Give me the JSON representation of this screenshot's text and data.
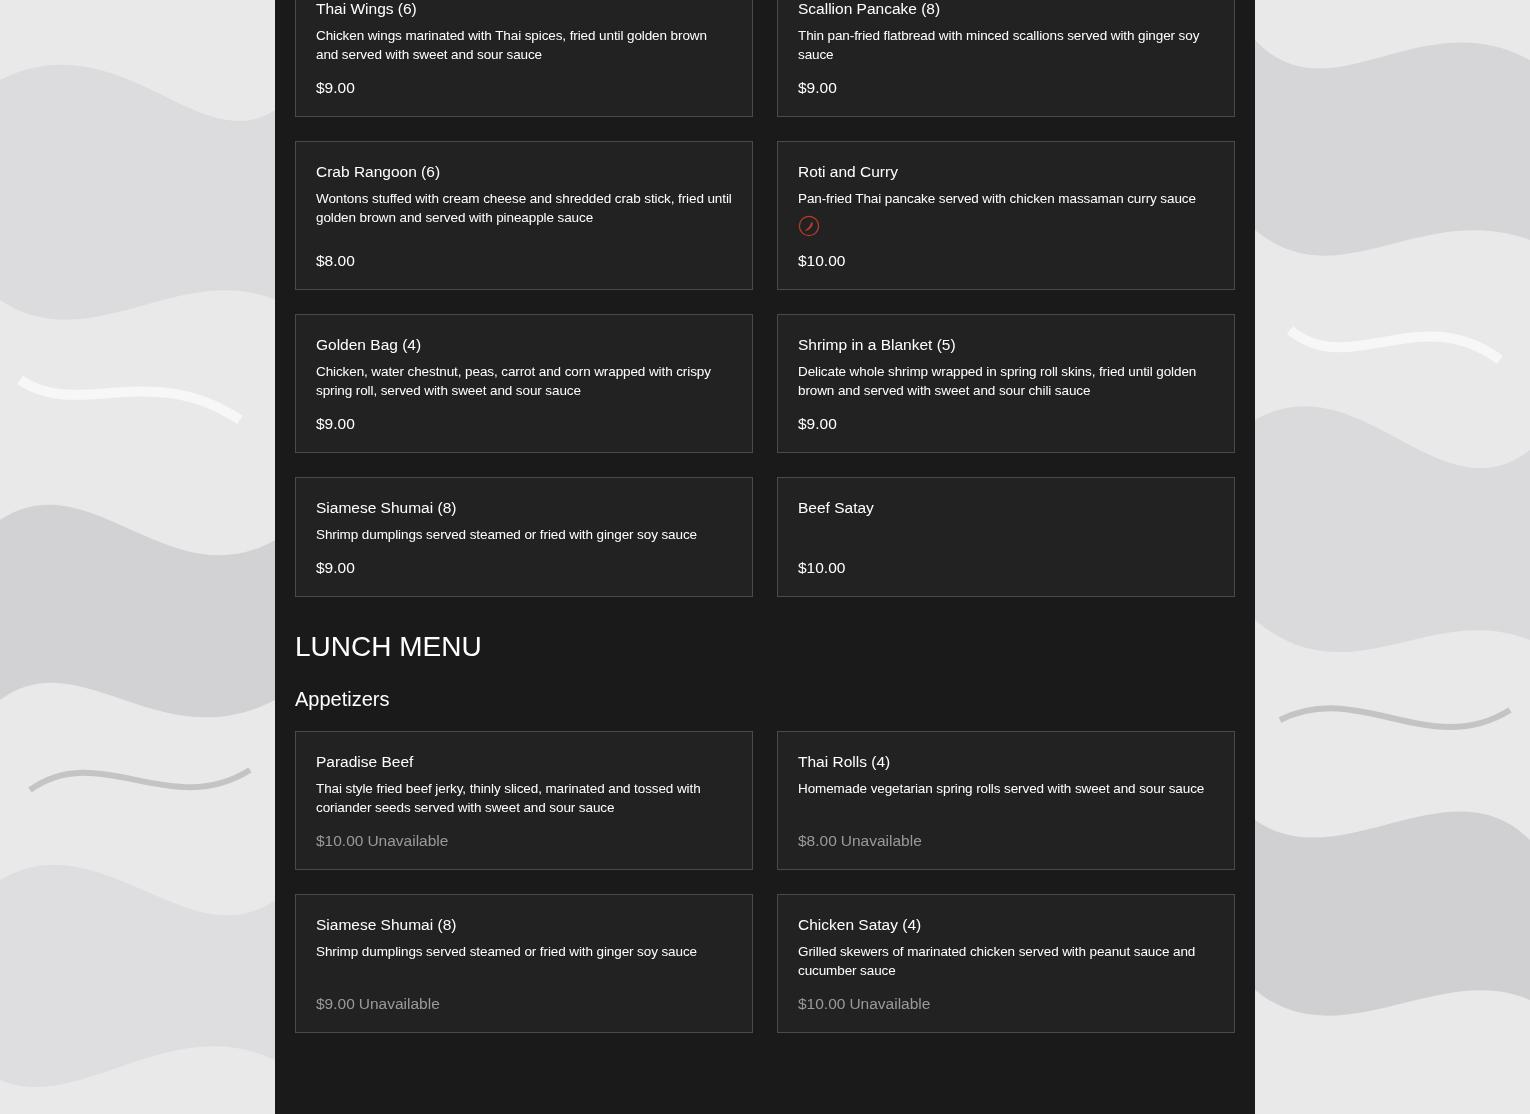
{
  "sections": [
    {
      "kind": "items",
      "items": [
        {
          "name": "Thai Wings (6)",
          "description": "Chicken wings marinated with Thai spices, fried until golden brown and served with sweet and sour sauce",
          "spicy": false,
          "price": "$9.00",
          "available": true
        },
        {
          "name": "Scallion Pancake (8)",
          "description": "Thin pan-fried flatbread with minced scallions served with ginger soy sauce",
          "spicy": false,
          "price": "$9.00",
          "available": true
        },
        {
          "name": "Crab Rangoon (6)",
          "description": "Wontons stuffed with cream cheese and shredded crab stick, fried until golden brown and served with pineapple sauce",
          "spicy": false,
          "price": "$8.00",
          "available": true
        },
        {
          "name": "Roti and Curry",
          "description": "Pan-fried Thai pancake served with chicken massaman curry sauce",
          "spicy": true,
          "price": "$10.00",
          "available": true
        },
        {
          "name": "Golden Bag (4)",
          "description": "Chicken, water chestnut, peas, carrot and corn wrapped with crispy spring roll, served with sweet and sour sauce",
          "spicy": false,
          "price": "$9.00",
          "available": true
        },
        {
          "name": "Shrimp in a Blanket (5)",
          "description": "Delicate whole shrimp wrapped in spring roll skins, fried until golden brown and served with sweet and sour chili sauce",
          "spicy": false,
          "price": "$9.00",
          "available": true
        },
        {
          "name": "Siamese Shumai (8)",
          "description": "Shrimp dumplings served steamed or fried with ginger soy sauce",
          "spicy": false,
          "price": "$9.00",
          "available": true
        },
        {
          "name": "Beef Satay",
          "spicy": false,
          "price": "$10.00",
          "available": true
        }
      ]
    },
    {
      "kind": "menu_title",
      "text": "LUNCH MENU"
    },
    {
      "kind": "category",
      "text": "Appetizers"
    },
    {
      "kind": "items",
      "items": [
        {
          "name": "Paradise Beef",
          "description": "Thai style fried beef jerky, thinly sliced, marinated and tossed with coriander seeds served with sweet and sour sauce",
          "spicy": false,
          "price": "$10.00",
          "available": false,
          "status": "Unavailable"
        },
        {
          "name": "Thai Rolls (4)",
          "description": "Homemade vegetarian spring rolls served with sweet and sour sauce",
          "spicy": false,
          "price": "$8.00",
          "available": false,
          "status": "Unavailable"
        },
        {
          "name": "Siamese Shumai (8)",
          "description": "Shrimp dumplings served steamed or fried with ginger soy sauce",
          "spicy": false,
          "price": "$9.00",
          "available": false,
          "status": "Unavailable"
        },
        {
          "name": "Chicken Satay (4)",
          "description": "Grilled skewers of marinated chicken served with peanut sauce and cucumber sauce",
          "spicy": false,
          "price": "$10.00",
          "available": false,
          "status": "Unavailable"
        }
      ]
    }
  ]
}
